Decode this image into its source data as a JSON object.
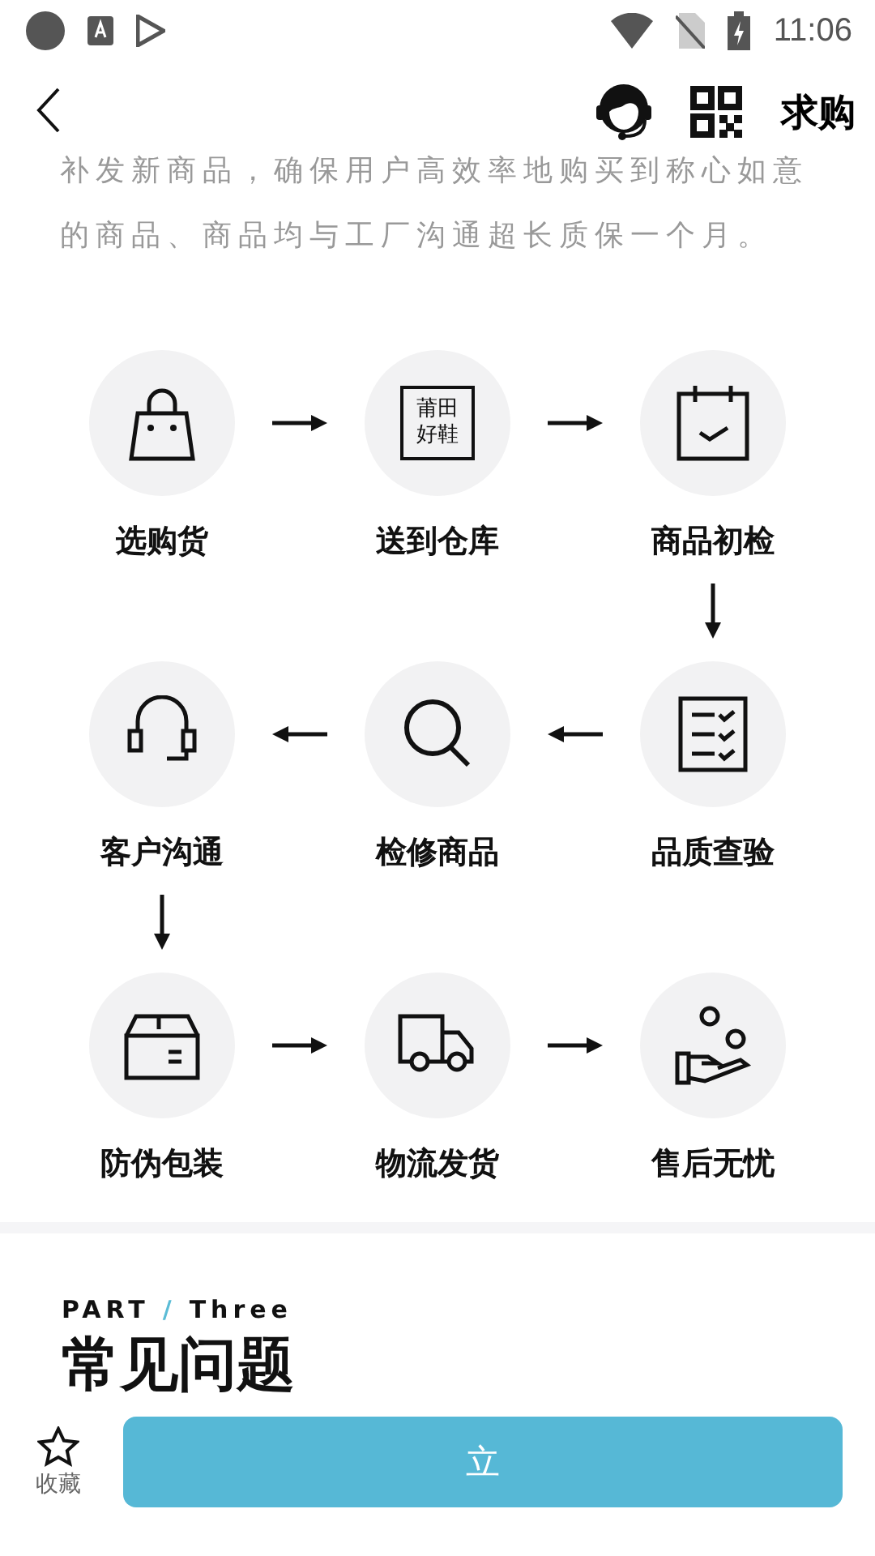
{
  "status_bar": {
    "time": "11:06"
  },
  "nav": {
    "action": "求购"
  },
  "intro": "补发新商品，确保用户高效率地购买到称心如意的商品、商品均与工厂沟通超长质保一个月。",
  "flow": [
    {
      "steps": [
        {
          "label": "选购货"
        },
        {
          "stamp_lines": [
            "莆田",
            "好鞋"
          ],
          "label": "送到仓库"
        },
        {
          "label": "商品初检"
        }
      ]
    },
    {
      "steps": [
        {
          "label": "客户沟通"
        },
        {
          "label": "检修商品"
        },
        {
          "label": "品质查验"
        }
      ]
    },
    {
      "steps": [
        {
          "label": "防伪包装"
        },
        {
          "label": "物流发货"
        },
        {
          "label": "售后无忧"
        }
      ]
    }
  ],
  "section": {
    "part": "PART",
    "slash": "/",
    "number": "Three",
    "title": "常见问题"
  },
  "bottom_bar": {
    "favorite": "收藏",
    "button": "立"
  }
}
